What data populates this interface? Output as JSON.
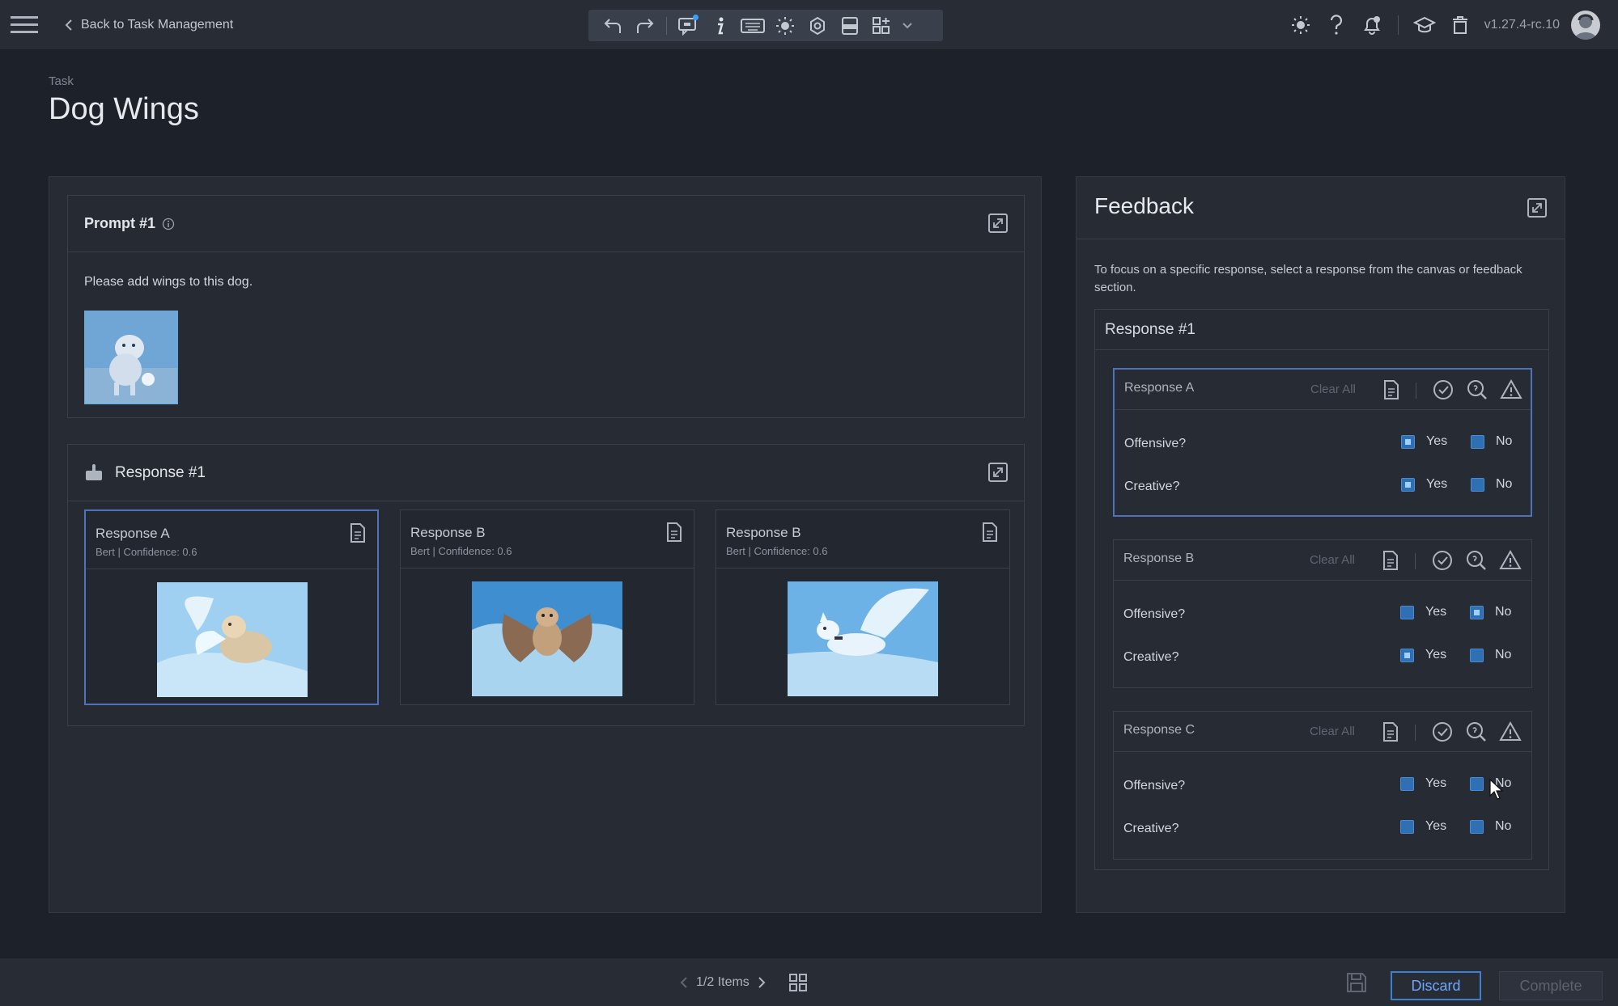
{
  "header": {
    "back_label": "Back to Task Management",
    "version": "v1.27.4-rc.10",
    "toolbar_icons": [
      "undo-icon",
      "redo-icon",
      "comment-icon",
      "info-icon",
      "keyboard-icon",
      "brightness-icon",
      "settings-icon",
      "pdf-icon",
      "layout-icon",
      "chevron-down-icon"
    ],
    "right_icons": [
      "theme-icon",
      "help-icon",
      "notifications-icon",
      "graduation-cap-icon",
      "trash-icon"
    ]
  },
  "page": {
    "kicker": "Task",
    "title": "Dog Wings"
  },
  "prompt": {
    "title": "Prompt #1",
    "text": "Please add wings to this dog."
  },
  "responses_section": {
    "title": "Response #1",
    "cards": [
      {
        "name": "Response A",
        "meta": "Bert | Confidence: 0.6"
      },
      {
        "name": "Response B",
        "meta": "Bert | Confidence: 0.6"
      },
      {
        "name": "Response B",
        "meta": "Bert | Confidence: 0.6"
      }
    ]
  },
  "feedback": {
    "title": "Feedback",
    "description": "To focus on a specific response, select a response from the canvas or feedback section.",
    "response_group": "Response #1",
    "clear_all": "Clear All",
    "yes_label": "Yes",
    "no_label": "No",
    "questions": [
      {
        "name": "Response A",
        "rows": [
          {
            "label": "Offensive?",
            "yes": true,
            "no": true
          },
          {
            "label": "Creative?",
            "yes": true,
            "no": true
          }
        ]
      },
      {
        "name": "Response B",
        "rows": [
          {
            "label": "Offensive?",
            "yes": false,
            "no": true
          },
          {
            "label": "Creative?",
            "yes": true,
            "no": false
          }
        ]
      },
      {
        "name": "Response C",
        "rows": [
          {
            "label": "Offensive?",
            "yes": false,
            "no": false
          },
          {
            "label": "Creative?",
            "yes": false,
            "no": false
          }
        ]
      }
    ]
  },
  "footer": {
    "pager": "1/2 Items",
    "discard_label": "Discard",
    "complete_label": "Complete"
  },
  "colors": {
    "accent": "#4e73b8",
    "checkbox": "#2f6fb3",
    "background": "#1d2129",
    "panel": "#262b34"
  }
}
